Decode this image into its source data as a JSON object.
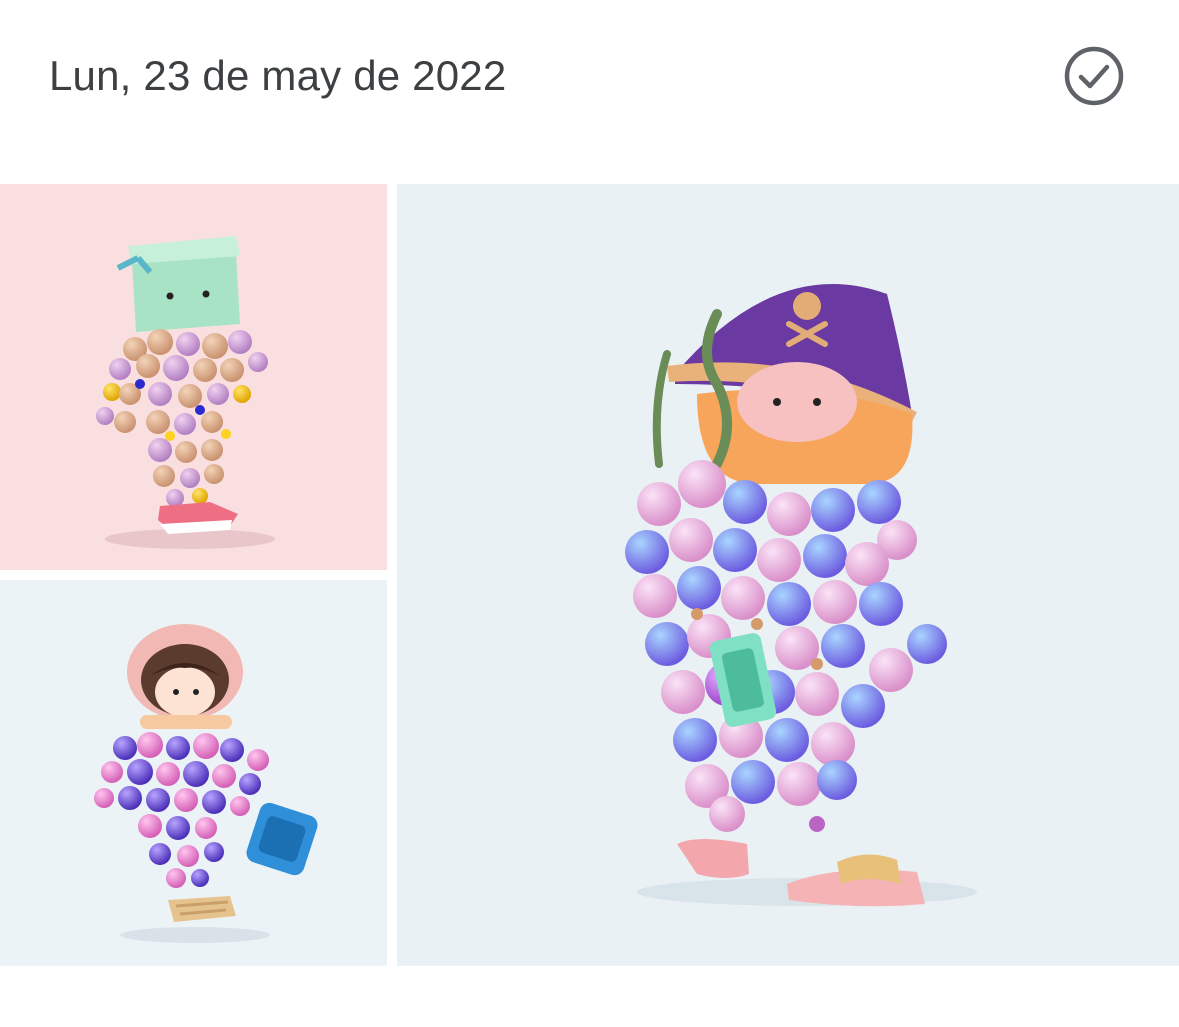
{
  "header": {
    "date": "Lun, 23 de may de 2022",
    "select_icon": "check-circle-icon"
  },
  "photos": [
    {
      "subject": "box-head character",
      "background": "#fadfe1"
    },
    {
      "subject": "astronaut character",
      "background": "#ecf3f6"
    },
    {
      "subject": "pirate character",
      "background": "#eaf1f5"
    }
  ],
  "colors": {
    "text": "#3c4043",
    "icon": "#5f6368"
  }
}
